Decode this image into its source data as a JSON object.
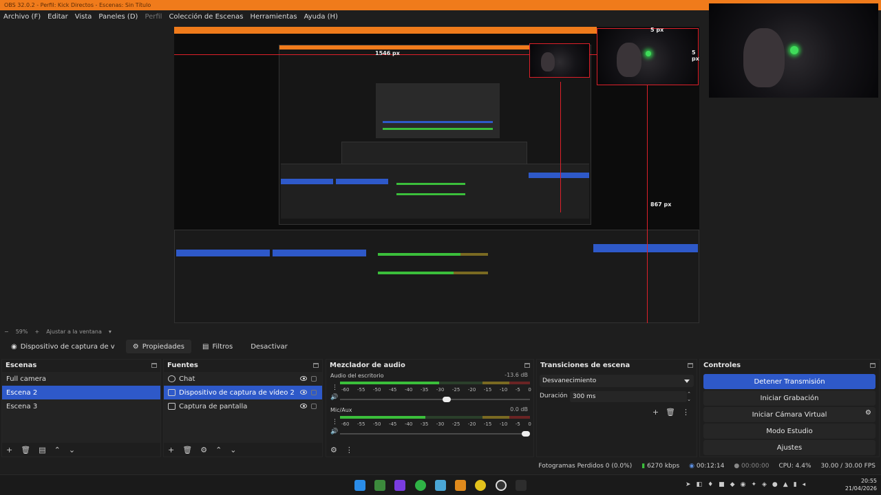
{
  "window": {
    "title": "OBS 32.0.2 - Perfil: Kick Directos - Escenas: Sin Título"
  },
  "menu": {
    "items": [
      "Archivo (F)",
      "Editar",
      "Vista",
      "Paneles (D)",
      "Perfil",
      "Colección de Escenas",
      "Herramientas",
      "Ayuda (H)"
    ]
  },
  "preview": {
    "measure_top": "5 px",
    "measure_right": "5 px",
    "measure_bottom": "867 px",
    "measure_width": "1546 px"
  },
  "zoom": {
    "value": "59%",
    "fit_label": "Ajustar a la ventana"
  },
  "source_toolbar": {
    "source_name": "Dispositivo de captura de v",
    "properties": "Propiedades",
    "filters": "Filtros",
    "deactivate": "Desactivar"
  },
  "scenes": {
    "title": "Escenas",
    "items": [
      {
        "label": "Full camera",
        "selected": false
      },
      {
        "label": "Escena 2",
        "selected": true
      },
      {
        "label": "Escena 3",
        "selected": false
      }
    ]
  },
  "sources": {
    "title": "Fuentes",
    "items": [
      {
        "label": "Chat",
        "icon": "browser-icon",
        "selected": false
      },
      {
        "label": "Dispositivo de captura de vídeo 2",
        "icon": "camera-icon",
        "selected": true
      },
      {
        "label": "Captura de pantalla",
        "icon": "monitor-icon",
        "selected": false
      }
    ]
  },
  "mixer": {
    "title": "Mezclador de audio",
    "channels": [
      {
        "name": "Audio del escritorio",
        "db": "-13.6 dB",
        "level": 0.52,
        "volume": 0.56
      },
      {
        "name": "Mic/Aux",
        "db": "0.0 dB",
        "level": 0.45,
        "volume": 0.98
      }
    ],
    "scale": [
      "-60",
      "-55",
      "-50",
      "-45",
      "-40",
      "-35",
      "-30",
      "-25",
      "-20",
      "-15",
      "-10",
      "-5",
      "0"
    ]
  },
  "transitions": {
    "title": "Transiciones de escena",
    "selected": "Desvanecimiento",
    "duration_label": "Duración",
    "duration_value": "300 ms"
  },
  "controls": {
    "title": "Controles",
    "stop_stream": "Detener Transmisión",
    "start_recording": "Iniciar Grabación",
    "start_virtual_cam": "Iniciar Cámara Virtual",
    "studio_mode": "Modo Estudio",
    "settings": "Ajustes"
  },
  "status": {
    "dropped_frames": "Fotogramas Perdidos 0 (0.0%)",
    "bitrate": "6270 kbps",
    "stream_time": "00:12:14",
    "rec_time": "00:00:00",
    "cpu": "CPU: 4.4%",
    "fps": "30.00 / 30.00 FPS"
  },
  "taskbar": {
    "time": "20:55",
    "date": "21/04/2026"
  },
  "colors": {
    "accent": "#2e59c9",
    "title_bar": "#f07b1b",
    "measure_line": "#e0202a"
  }
}
